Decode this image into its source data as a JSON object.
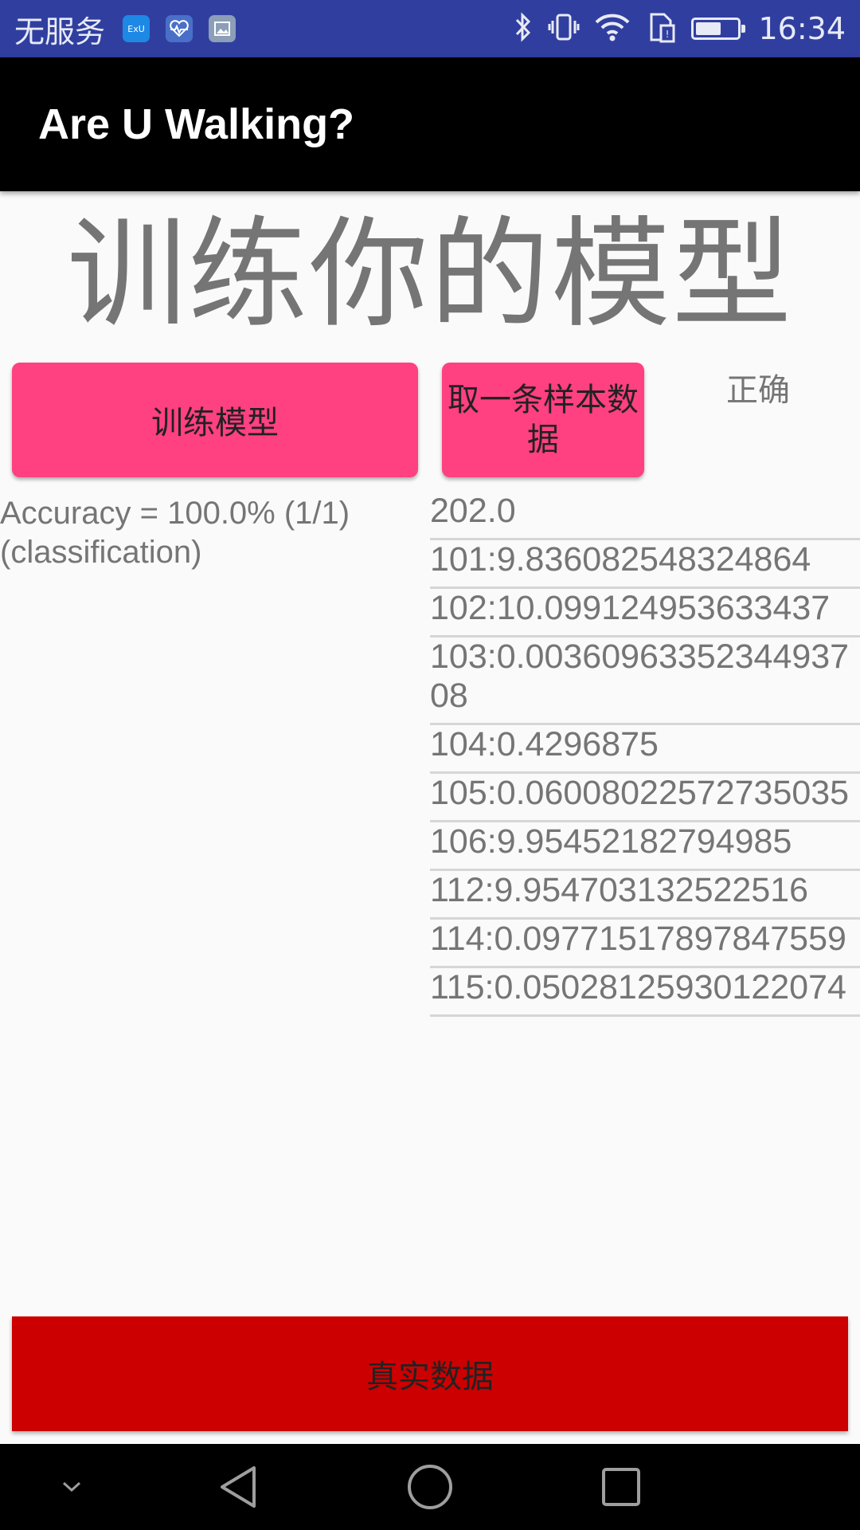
{
  "status_bar": {
    "carrier": "无服务",
    "app_icon_1_label": "ExU",
    "time": "16:34",
    "battery_level": 0.55,
    "icons": [
      "exu-app-icon",
      "health-app-icon",
      "gallery-app-icon",
      "bluetooth-icon",
      "vibrate-icon",
      "wifi-icon",
      "sim-icon",
      "battery-icon"
    ]
  },
  "app_bar": {
    "title": "Are U Walking?"
  },
  "main": {
    "heading": "训练你的模型",
    "train_button": "训练模型",
    "sample_button": "取一条样本数据",
    "result_label": "正确",
    "accuracy_text": "Accuracy = 100.0% (1/1) (classification)",
    "data_rows": [
      "202.0",
      "101:9.836082548324864",
      "102:10.099124953633437",
      "103:0.0036096335234493708",
      "104:0.4296875",
      "105:0.0600802257273503​5",
      "106:9.95452182794985",
      "112:9.954703132522516",
      "114:0.09771517897847559",
      "115:0.05028125930122074"
    ],
    "real_data_button": "真实数据"
  },
  "colors": {
    "status_bar": "#303f9f",
    "app_bar": "#000000",
    "accent_button": "#ff4081",
    "real_button": "#cc0000",
    "text_gray": "#757575"
  },
  "nav_bar": {
    "icons": [
      "chevron-down-icon",
      "back-icon",
      "home-icon",
      "recents-icon"
    ]
  }
}
